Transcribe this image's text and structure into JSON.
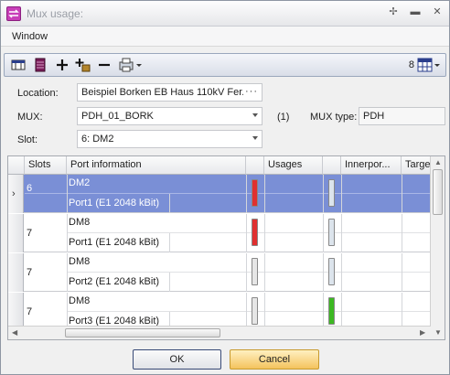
{
  "window": {
    "title": "Mux usage:",
    "buttons": {
      "pin": "✢",
      "minimize": "▬",
      "close": "✕"
    }
  },
  "menu": {
    "window": "Window"
  },
  "toolbar": {
    "count": "8"
  },
  "form": {
    "location_label": "Location:",
    "location_value": "Beispiel Borken EB Haus 110kV Fer...",
    "mux_label": "MUX:",
    "mux_value": "PDH_01_BORK",
    "mux_count": "(1)",
    "mux_type_label": "MUX type:",
    "mux_type_value": "PDH",
    "slot_label": "Slot:",
    "slot_value": "6: DM2"
  },
  "grid": {
    "columns": [
      "Slots",
      "Port information",
      "",
      "Usages",
      "",
      "Innerpor...",
      "Targe"
    ],
    "rows": [
      {
        "slot": "6",
        "port_name": "DM2",
        "port_detail": "Port1 (E1 2048 kBit)",
        "status_color": "#e03030",
        "inner_color": "#dce4ec",
        "selected": true
      },
      {
        "slot": "7",
        "port_name": "DM8",
        "port_detail": "Port1 (E1 2048 kBit)",
        "status_color": "#e03030",
        "inner_color": "#dce4ec",
        "selected": false
      },
      {
        "slot": "7",
        "port_name": "DM8",
        "port_detail": "Port2 (E1 2048 kBit)",
        "status_color": "#e6e6e6",
        "inner_color": "#dce4ec",
        "selected": false
      },
      {
        "slot": "7",
        "port_name": "DM8",
        "port_detail": "Port3 (E1 2048 kBit)",
        "status_color": "#e6e6e6",
        "inner_color": "#3cb822",
        "selected": false
      }
    ]
  },
  "buttons": {
    "ok": "OK",
    "cancel": "Cancel"
  }
}
